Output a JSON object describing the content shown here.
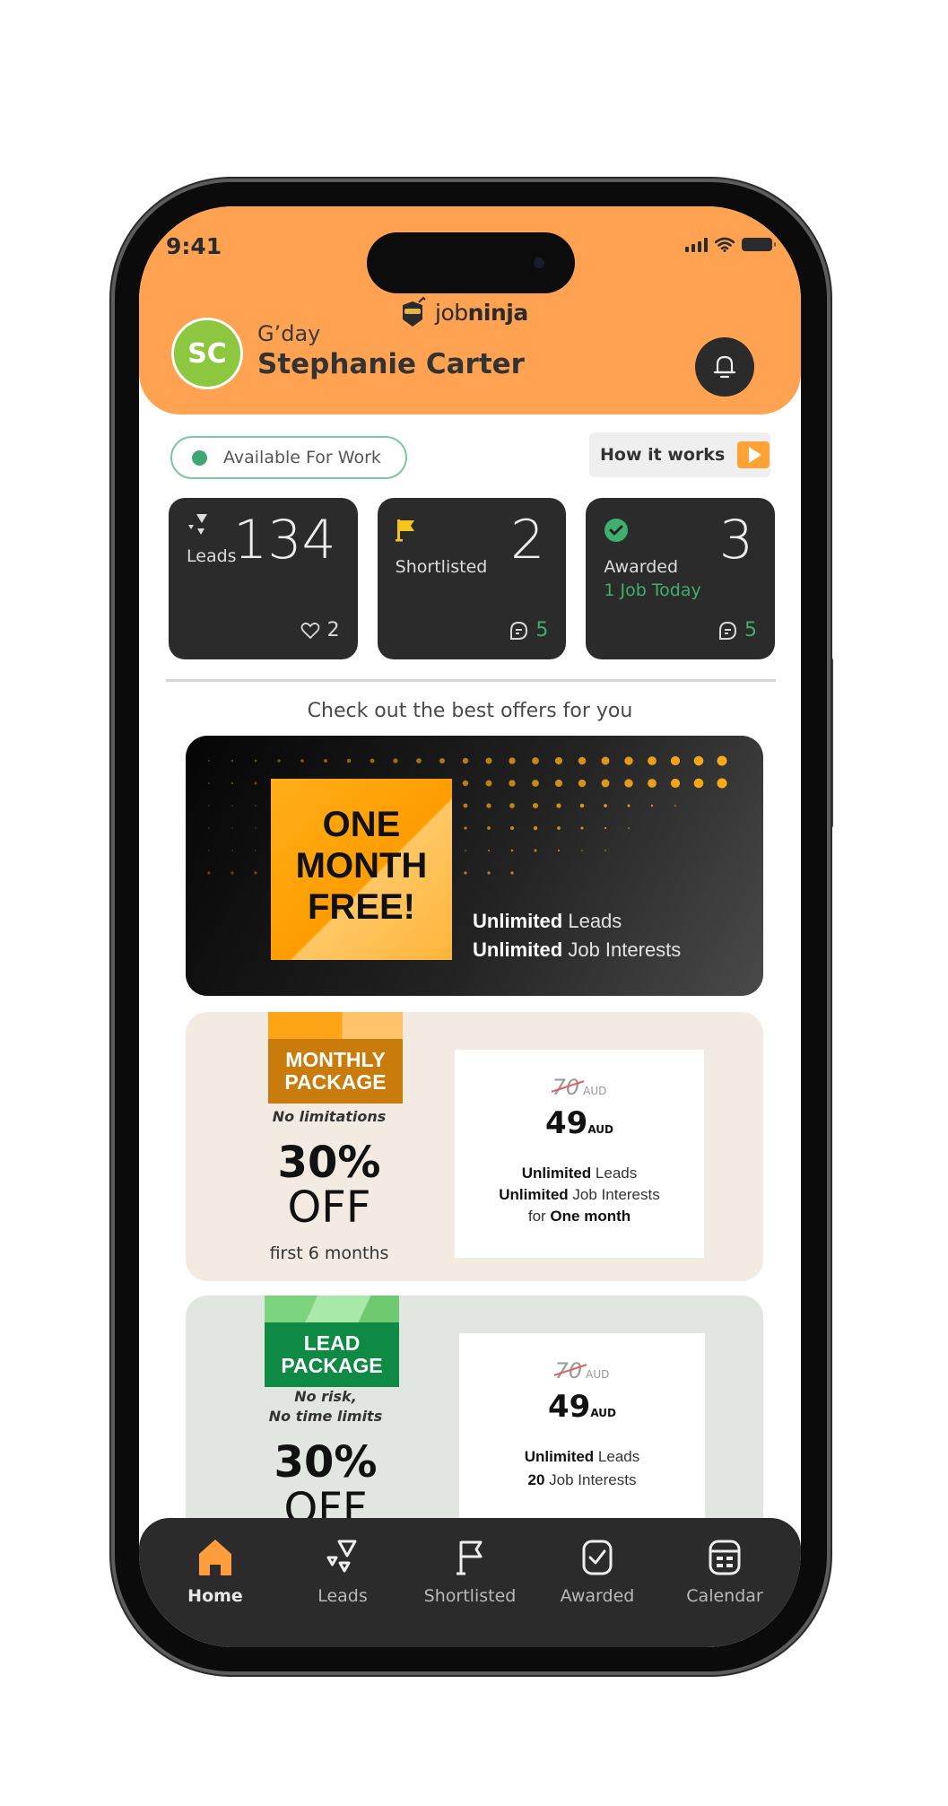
{
  "status_bar": {
    "time": "9:41"
  },
  "header": {
    "brand_prefix": "job",
    "brand_suffix": "ninja",
    "avatar_initials": "SC",
    "greeting": "G’day",
    "user_name": "Stephanie Carter"
  },
  "availability": {
    "label": "Available For Work",
    "status_color": "#3fa672"
  },
  "how_it_works": {
    "label": "How it works"
  },
  "stats": [
    {
      "label": "Leads",
      "count": "134",
      "footer_icon": "heart-icon",
      "footer_value": "2"
    },
    {
      "label": "Shortlisted",
      "count": "2",
      "footer_icon": "chat-icon",
      "footer_value": "5"
    },
    {
      "label": "Awarded",
      "count": "3",
      "sub": "1 Job Today",
      "footer_icon": "chat-icon",
      "footer_value": "5"
    }
  ],
  "offers": {
    "title": "Check out the best offers for you",
    "promo": {
      "headline": [
        "ONE",
        "MONTH",
        "FREE!"
      ],
      "lines": [
        {
          "bold": "Unlimited",
          "rest": " Leads"
        },
        {
          "bold": "Unlimited",
          "rest": " Job Interests"
        }
      ]
    },
    "packages": [
      {
        "badge": [
          "MONTHLY",
          "PACKAGE"
        ],
        "badge_color": "#c97c0c",
        "tagline": [
          "No limitations"
        ],
        "discount": "30%",
        "off": "OFF",
        "note": "first 6 months",
        "old_price": "70",
        "new_price": "49",
        "currency": "AUD",
        "features": [
          {
            "bold": "Unlimited",
            "rest": " Leads"
          },
          {
            "bold": "Unlimited",
            "rest": " Job Interests"
          },
          {
            "pre": "for ",
            "bold": "One month"
          }
        ]
      },
      {
        "badge": [
          "LEAD",
          "PACKAGE"
        ],
        "badge_color": "#0f8a45",
        "tagline": [
          "No risk,",
          "No time limits"
        ],
        "discount": "30%",
        "off": "OFF",
        "old_price": "70",
        "new_price": "49",
        "currency": "AUD",
        "features": [
          {
            "bold": "Unlimited",
            "rest": " Leads"
          },
          {
            "bold": "20",
            "rest": " Job Interests"
          }
        ]
      }
    ]
  },
  "bottom_nav": [
    {
      "label": "Home",
      "icon": "home-icon",
      "active": true
    },
    {
      "label": "Leads",
      "icon": "leads-icon"
    },
    {
      "label": "Shortlisted",
      "icon": "flag-icon"
    },
    {
      "label": "Awarded",
      "icon": "check-square-icon"
    },
    {
      "label": "Calendar",
      "icon": "calendar-icon"
    }
  ],
  "colors": {
    "header_orange": "#ffa352",
    "card_dark": "#2b2b2b",
    "accent_green": "#3fae6e",
    "home_active": "#ff9c3c"
  }
}
